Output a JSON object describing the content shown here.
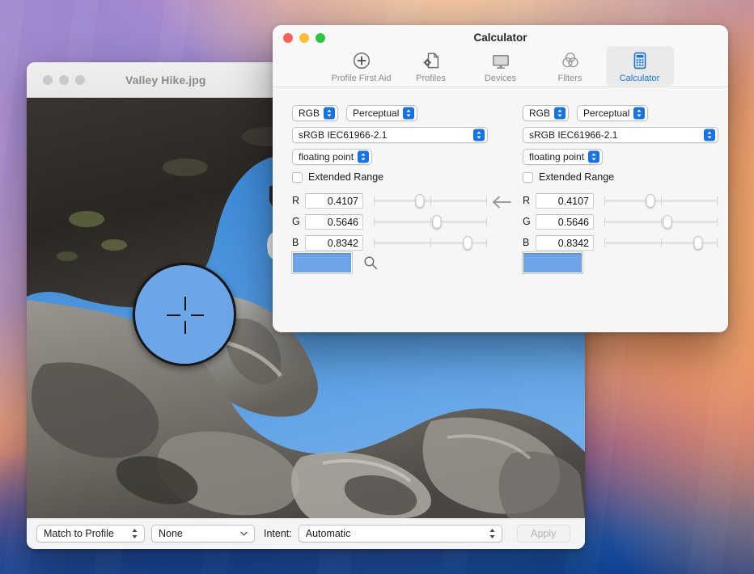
{
  "image_window": {
    "title": "Valley Hike.jpg",
    "traffic_lights": [
      "close-inactive",
      "minimize-inactive",
      "zoom-inactive"
    ],
    "bottom_bar": {
      "match_popup": "Match to Profile",
      "profile_dropdown": "None",
      "intent_label": "Intent:",
      "intent_popup": "Automatic",
      "apply_button": "Apply"
    },
    "loupe": {
      "sampled_color": "#6ca5e8",
      "crosshair_icon": "crosshair-icon"
    }
  },
  "calculator_window": {
    "title": "Calculator",
    "traffic_lights": {
      "close": "#ff5f57",
      "minimize": "#febc2e",
      "zoom": "#28c840"
    },
    "toolbar": {
      "selected": "Calculator",
      "items": [
        {
          "label": "Profile First Aid",
          "icon": "first-aid-circle-plus-icon"
        },
        {
          "label": "Profiles",
          "icon": "document-gear-icon"
        },
        {
          "label": "Devices",
          "icon": "display-monitor-icon"
        },
        {
          "label": "Filters",
          "icon": "overlapping-circles-icon"
        },
        {
          "label": "Calculator",
          "icon": "calculator-icon"
        }
      ]
    },
    "accent_color": "#1473e6",
    "panels": [
      {
        "side": "left",
        "color_space": "RGB",
        "rendering_intent": "Perceptual",
        "profile": "sRGB IEC61966-2.1",
        "data_type": "floating point",
        "extended_range_label": "Extended Range",
        "extended_range_checked": false,
        "channels": [
          {
            "label": "R",
            "value": "0.4107",
            "slider_pct": 41
          },
          {
            "label": "G",
            "value": "0.5646",
            "slider_pct": 56
          },
          {
            "label": "B",
            "value": "0.8342",
            "slider_pct": 83
          }
        ],
        "swatch_color": "#6ea5e8",
        "loupe_tool_icon": "magnifier-icon"
      },
      {
        "side": "right",
        "color_space": "RGB",
        "rendering_intent": "Perceptual",
        "profile": "sRGB IEC61966-2.1",
        "data_type": "floating point",
        "extended_range_label": "Extended Range",
        "extended_range_checked": false,
        "channels": [
          {
            "label": "R",
            "value": "0.4107",
            "slider_pct": 41
          },
          {
            "label": "G",
            "value": "0.5646",
            "slider_pct": 56
          },
          {
            "label": "B",
            "value": "0.8342",
            "slider_pct": 83
          }
        ],
        "swatch_color": "#6ea5e8"
      }
    ],
    "transfer_arrow_icon": "arrow-left-icon"
  }
}
